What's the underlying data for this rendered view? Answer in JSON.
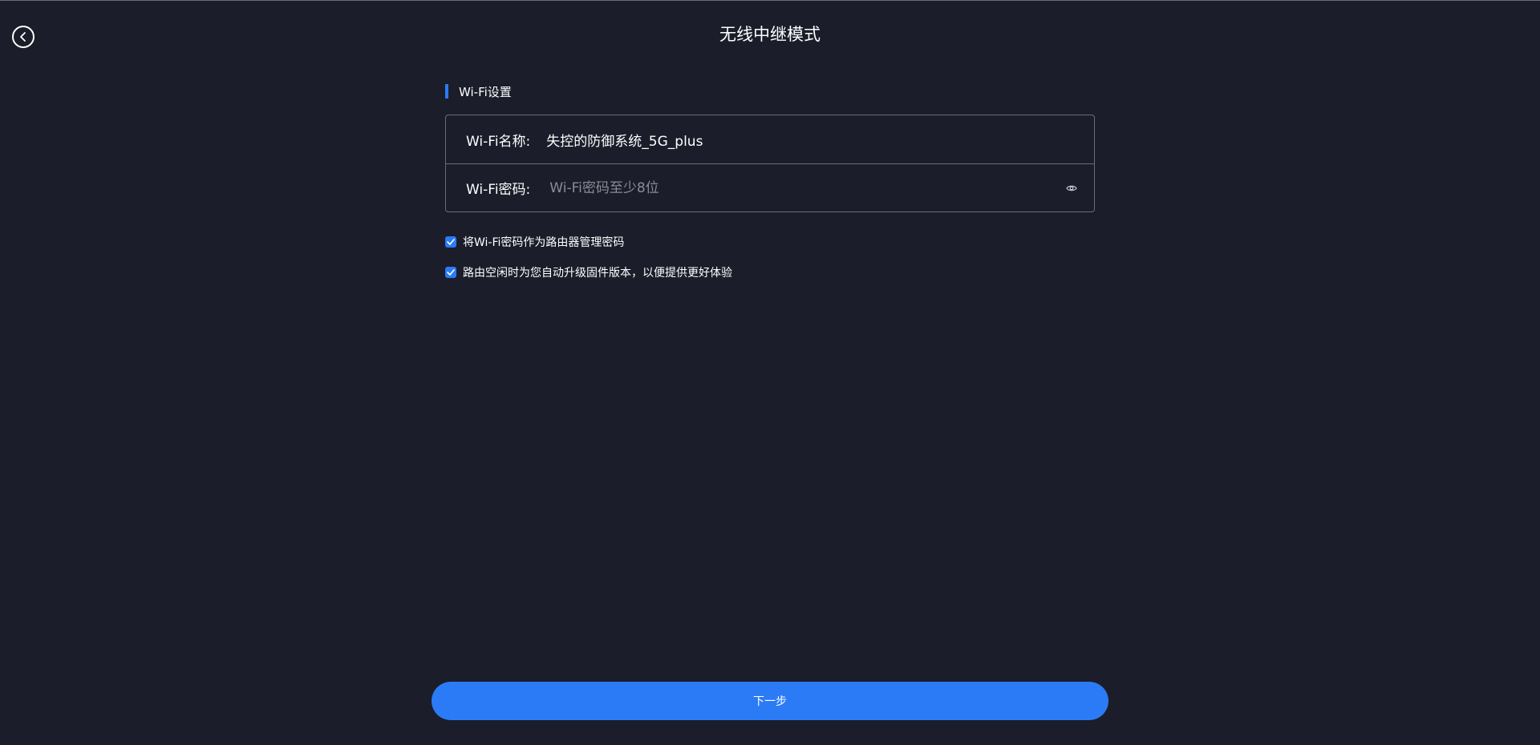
{
  "header": {
    "title": "无线中继模式",
    "back_icon": "back-arrow-circle-icon"
  },
  "section": {
    "title": "Wi-Fi设置"
  },
  "form": {
    "name_label": "Wi-Fi名称:",
    "name_value": "失控的防御系统_5G_plus",
    "password_label": "Wi-Fi密码:",
    "password_value": "",
    "password_placeholder": "Wi-Fi密码至少8位",
    "password_visibility_icon": "eye-icon"
  },
  "options": [
    {
      "label": "将Wi-Fi密码作为路由器管理密码",
      "checked": true
    },
    {
      "label": "路由空闲时为您自动升级固件版本，以便提供更好体验",
      "checked": true
    }
  ],
  "footer": {
    "next_label": "下一步"
  },
  "colors": {
    "background": "#1b1d2a",
    "accent": "#2b7bf6",
    "border": "#6a6d78",
    "placeholder": "#8a8c96"
  }
}
